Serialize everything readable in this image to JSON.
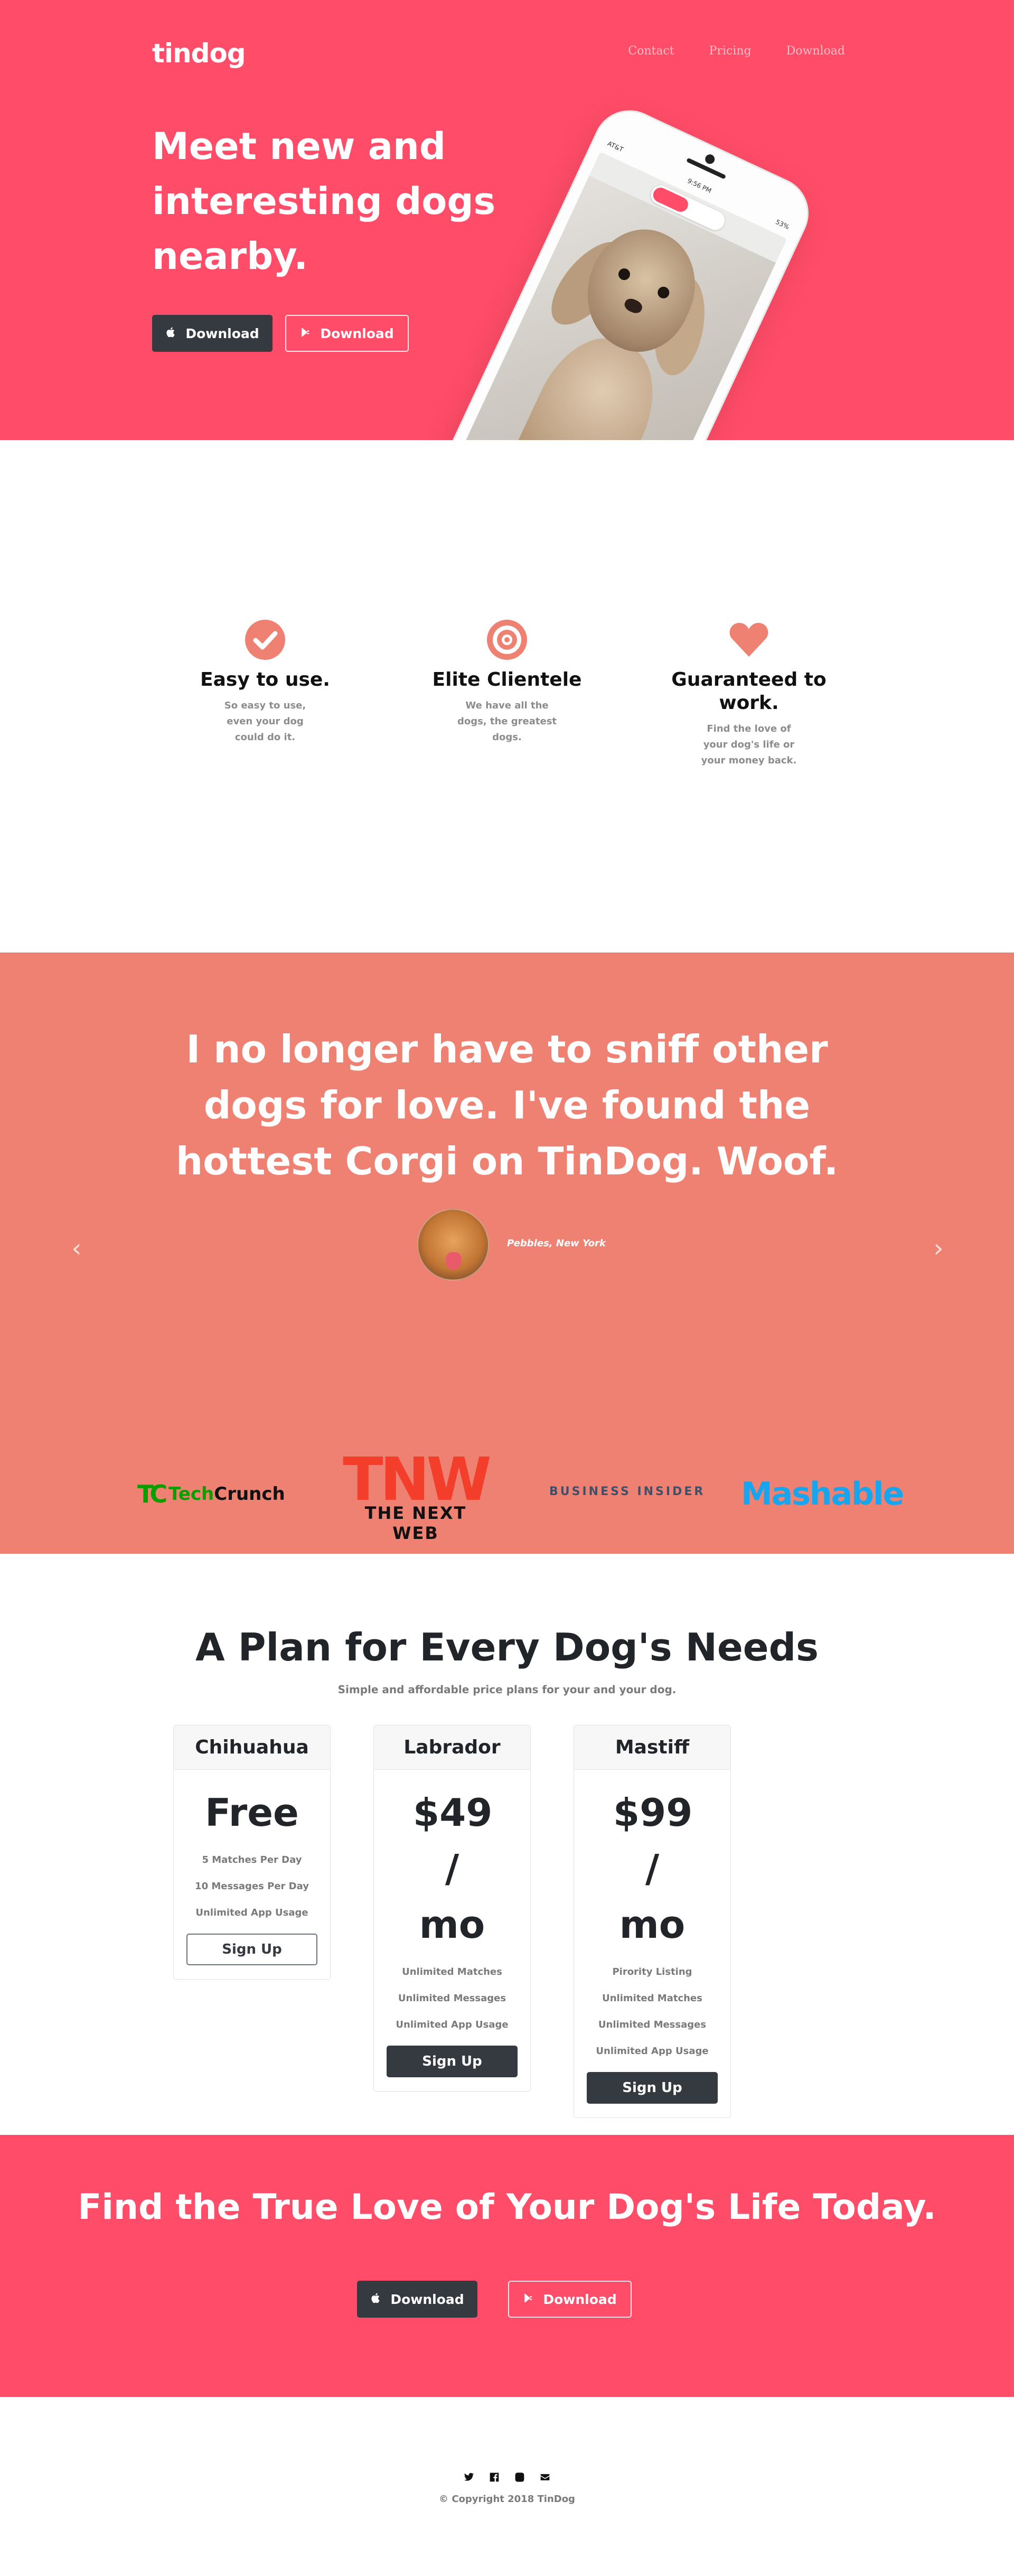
{
  "hero": {
    "logo": "tindog",
    "nav": [
      "Contact",
      "Pricing",
      "Download"
    ],
    "title": "Meet new and interesting dogs nearby.",
    "buttons": [
      {
        "label": "Download",
        "icon": "apple-icon"
      },
      {
        "label": "Download",
        "icon": "google-play-icon"
      }
    ],
    "phone": {
      "carrier": "AT&T",
      "time": "9:56 PM",
      "battery": "53%"
    }
  },
  "features": [
    {
      "icon": "check-circle-icon",
      "title": "Easy to use.",
      "text": "So easy to use, even your dog could do it."
    },
    {
      "icon": "bullseye-icon",
      "title": "Elite Clientele",
      "text": "We have all the dogs, the greatest dogs."
    },
    {
      "icon": "heart-icon",
      "title": "Guaranteed to work.",
      "text": "Find the love of your dog's life or your money back."
    }
  ],
  "testimonial": {
    "quote": "I no longer have to sniff other dogs for love. I've found the hottest Corgi on TinDog. Woof.",
    "author": "Pebbles, New York"
  },
  "press": {
    "techcrunch": {
      "mark": "TC",
      "tech": "Tech",
      "crunch": "Crunch"
    },
    "tnw": {
      "mark": "TNW",
      "name": "THE NEXT WEB"
    },
    "business_insider": "BUSINESS INSIDER",
    "mashable": "Mashable"
  },
  "pricing": {
    "title": "A Plan for Every Dog's Needs",
    "subtitle": "Simple and affordable price plans for your and your dog.",
    "plans": [
      {
        "name": "Chihuahua",
        "price": "Free",
        "features": [
          "5 Matches Per Day",
          "10 Messages Per Day",
          "Unlimited App Usage"
        ],
        "button": "Sign Up"
      },
      {
        "name": "Labrador",
        "price": "$49 / mo",
        "features": [
          "Unlimited Matches",
          "Unlimited Messages",
          "Unlimited App Usage"
        ],
        "button": "Sign Up"
      },
      {
        "name": "Mastiff",
        "price": "$99 / mo",
        "features": [
          "Pirority Listing",
          "Unlimited Matches",
          "Unlimited Messages",
          "Unlimited App Usage"
        ],
        "button": "Sign Up"
      }
    ]
  },
  "cta": {
    "title": "Find the True Love of Your Dog's Life Today.",
    "buttons": [
      {
        "label": "Download",
        "icon": "apple-icon"
      },
      {
        "label": "Download",
        "icon": "google-play-icon"
      }
    ]
  },
  "footer": {
    "social_icons": [
      "twitter-icon",
      "facebook-icon",
      "instagram-icon",
      "envelope-icon"
    ],
    "copyright": "© Copyright 2018 TinDog"
  },
  "colors": {
    "brand_red": "#ff4c68",
    "testimonial_bg": "#ef8172",
    "dark": "#343a40",
    "feature_icon": "#ef8172"
  }
}
